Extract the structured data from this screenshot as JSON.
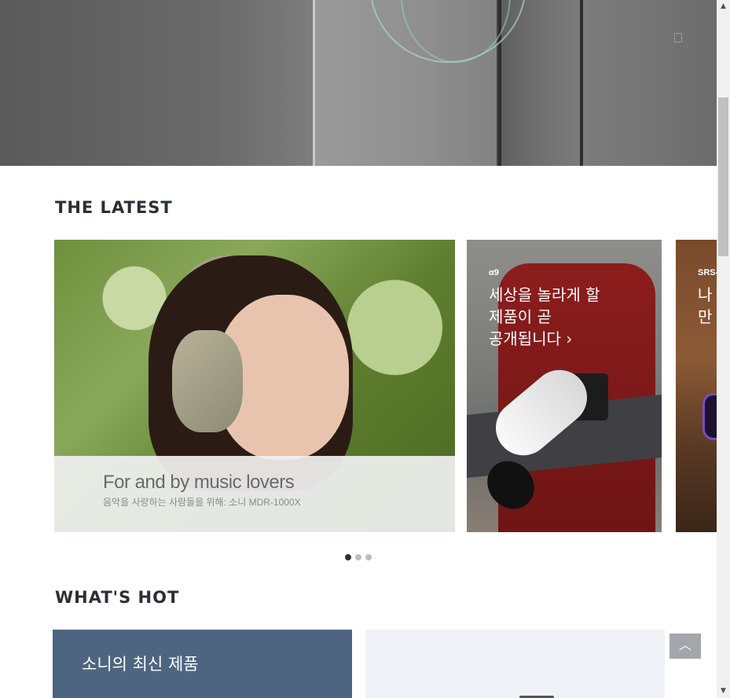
{
  "hero": {
    "icon": "phone-product-image"
  },
  "latest": {
    "title": "THE LATEST",
    "cards": [
      {
        "caption_title": "For and by music lovers",
        "caption_subtitle": "음악을 사랑하는 사람들을 위해: 소니 MDR-1000X"
      },
      {
        "tag": "α9",
        "line1": "세상을 놀라게 할",
        "line2": "제품이 곧",
        "line3": "공개됩니다 ›"
      },
      {
        "tag": "SRS-",
        "line1": "나",
        "line2": "만"
      }
    ],
    "carousel": {
      "total": 3,
      "active": 1
    }
  },
  "hot": {
    "title": "WHAT'S HOT",
    "card1_title": "소니의 최신 제품"
  },
  "top_button": {
    "label": "︿"
  },
  "scrollbar": {
    "up": "▲",
    "down": "▼"
  },
  "colors": {
    "accent_dark": "#2c2f3a",
    "hot_card": "#4d6580"
  }
}
